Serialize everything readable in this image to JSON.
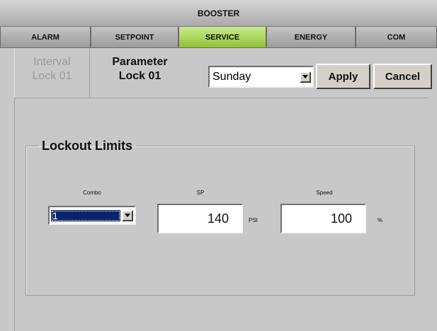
{
  "title": "BOOSTER",
  "nav_tabs": [
    {
      "label": "ALARM",
      "active": false
    },
    {
      "label": "SETPOINT",
      "active": false
    },
    {
      "label": "SERVICE",
      "active": true
    },
    {
      "label": "ENERGY",
      "active": false
    },
    {
      "label": "COM",
      "active": false
    }
  ],
  "sub_tabs": [
    {
      "line1": "Interval",
      "line2": "Lock 01",
      "active": false
    },
    {
      "line1": "Parameter",
      "line2": "Lock 01",
      "active": true
    }
  ],
  "day_select": {
    "value": "Sunday"
  },
  "buttons": {
    "apply": "Apply",
    "cancel": "Cancel"
  },
  "lockout": {
    "legend": "Lockout Limits",
    "combo_label": "Combo",
    "combo_value": "1",
    "sp_label": "SP",
    "sp_value": "140",
    "sp_unit": "PSI",
    "speed_label": "Speed",
    "speed_value": "100",
    "speed_unit": "%"
  },
  "colors": {
    "active_tab": "#9ccd45",
    "background": "#c8c8c8",
    "selection": "#0a246a"
  },
  "icons": {
    "dropdown": "chevron-down-icon"
  }
}
